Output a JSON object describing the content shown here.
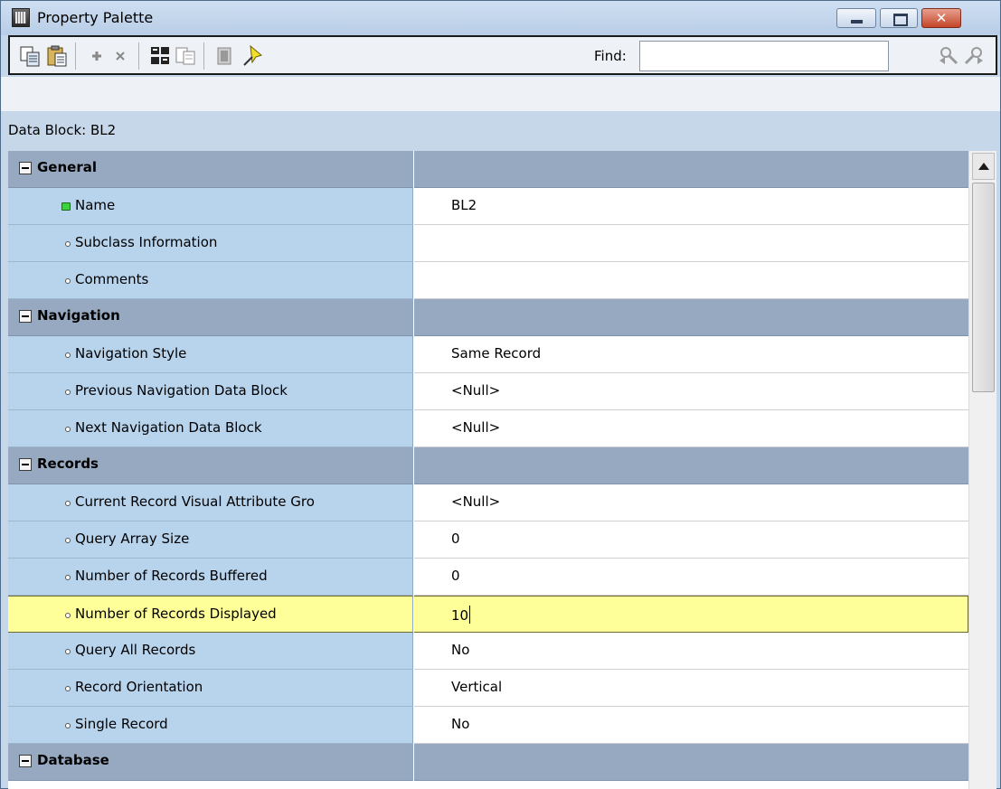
{
  "window": {
    "title": "Property Palette",
    "close_glyph": "✕"
  },
  "toolbar": {
    "find_label": "Find:",
    "find_value": "",
    "icons": [
      "copy-properties-icon",
      "paste-properties-icon",
      "add-property-icon",
      "delete-property-icon",
      "union-icon",
      "intersection-icon",
      "inherit-icon",
      "pin-icon",
      "find-previous-icon",
      "find-next-icon"
    ]
  },
  "context": {
    "label": "Data Block: BL2"
  },
  "property_groups": [
    {
      "name": "General",
      "properties": [
        {
          "label": "Name",
          "value": "BL2",
          "marker": "green"
        },
        {
          "label": "Subclass Information",
          "value": ""
        },
        {
          "label": "Comments",
          "value": ""
        }
      ]
    },
    {
      "name": "Navigation",
      "properties": [
        {
          "label": "Navigation Style",
          "value": "Same Record"
        },
        {
          "label": "Previous Navigation Data Block",
          "value": "<Null>"
        },
        {
          "label": "Next Navigation Data Block",
          "value": "<Null>"
        }
      ]
    },
    {
      "name": "Records",
      "properties": [
        {
          "label": "Current Record Visual Attribute Gro",
          "value": "<Null>"
        },
        {
          "label": "Query Array Size",
          "value": "0"
        },
        {
          "label": "Number of Records Buffered",
          "value": "0"
        },
        {
          "label": "Number of Records Displayed",
          "value": "10",
          "selected": true
        },
        {
          "label": "Query All Records",
          "value": "No"
        },
        {
          "label": "Record Orientation",
          "value": "Vertical"
        },
        {
          "label": "Single Record",
          "value": "No"
        }
      ]
    },
    {
      "name": "Database",
      "properties": []
    }
  ],
  "colors": {
    "label_column": "#b8d3ec",
    "group_header": "#97a9c1",
    "selected_row": "#ffff99"
  }
}
